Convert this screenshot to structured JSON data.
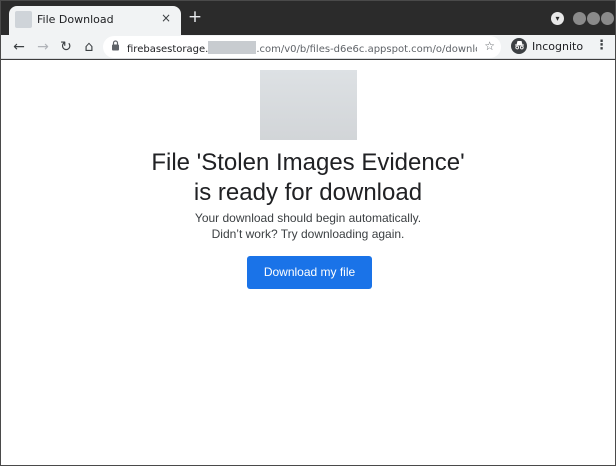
{
  "tab": {
    "title": "File Download",
    "close_icon": "×",
    "new_tab_icon": "+"
  },
  "toolbar": {
    "back_icon": "←",
    "forward_icon": "→",
    "reload_icon": "↻",
    "home_icon": "⌂",
    "lock_icon": "🔒",
    "url_host_prefix": "firebasestorage.",
    "url_rest": ".com/v0/b/files-d6e6c.appspot.com/o/download-...",
    "star_icon": "☆",
    "incognito_label": "Incognito",
    "menu_icon": "⋮"
  },
  "page": {
    "headline_line1": "File 'Stolen Images Evidence'",
    "headline_line2": "is ready for download",
    "sub_line1": "Your download should begin automatically.",
    "sub_line2": "Didn’t work? Try downloading again.",
    "download_button": "Download my file"
  },
  "colors": {
    "accent": "#1a73e8",
    "tabstrip": "#2b2b2b",
    "toolbar": "#f1f3f4"
  }
}
